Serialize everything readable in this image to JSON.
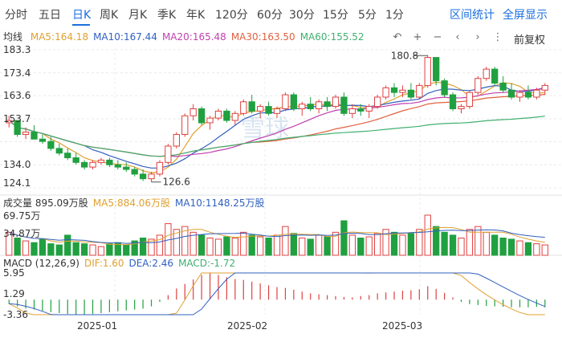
{
  "tabs": {
    "items": [
      "分时",
      "五日",
      "日K",
      "周K",
      "月K",
      "季K",
      "年K",
      "120分",
      "60分",
      "30分",
      "15分",
      "5分",
      "1分"
    ],
    "active_index": 2,
    "right": [
      "区间统计",
      "全屏显示"
    ]
  },
  "ma_legend": {
    "title": "均线",
    "items": [
      {
        "text": "MA5:164.18",
        "color": "#e0a030"
      },
      {
        "text": "MA10:167.44",
        "color": "#3060c0"
      },
      {
        "text": "MA20:165.48",
        "color": "#c040b0"
      },
      {
        "text": "MA30:163.50",
        "color": "#e06040"
      },
      {
        "text": "MA60:155.52",
        "color": "#40b070"
      }
    ]
  },
  "toolbar": {
    "icons": [
      "undo-icon",
      "zoom-in-icon",
      "zoom-out-icon",
      "prev-icon",
      "next-icon",
      "more-icon"
    ],
    "glyphs": [
      "↶",
      "+",
      "−",
      "‹",
      "›",
      "⋮"
    ],
    "adjust_label": "前复权"
  },
  "price_axis": [
    "183.3",
    "173.4",
    "163.6",
    "153.7",
    "134.0",
    "124.1"
  ],
  "annotations": {
    "high": "180.8",
    "low": "126.6"
  },
  "volume_legend": {
    "items": [
      {
        "text": "成交量 895.09万股",
        "color": "#333333"
      },
      {
        "text": "MA5:884.06万股",
        "color": "#e0a030"
      },
      {
        "text": "MA10:1148.25万股",
        "color": "#3060c0"
      }
    ],
    "axis": [
      "69.75万",
      "34.87万"
    ]
  },
  "macd_legend": {
    "items": [
      {
        "text": "MACD (12,26,9)",
        "color": "#333333"
      },
      {
        "text": "DIF:1.60",
        "color": "#e0a030"
      },
      {
        "text": "DEA:2.46",
        "color": "#3060c0"
      },
      {
        "text": "MACD:-1.72",
        "color": "#40b070"
      }
    ],
    "axis": [
      "5.95",
      "1.29",
      "-3.36"
    ]
  },
  "x_dates": [
    "2025-01",
    "2025-02",
    "2025-03"
  ],
  "watermark": "雪球",
  "colors": {
    "up": "#e04040",
    "down": "#20a040",
    "active": "#1a6fe0"
  },
  "chart_data": {
    "type": "candlestick",
    "ylim": [
      124.1,
      183.3
    ],
    "candles": [
      [
        152,
        155,
        150,
        153
      ],
      [
        153,
        153,
        146,
        147
      ],
      [
        147,
        150,
        145,
        148
      ],
      [
        148,
        151,
        146,
        145
      ],
      [
        145,
        147,
        143,
        144
      ],
      [
        144,
        146,
        140,
        141
      ],
      [
        141,
        143,
        138,
        139
      ],
      [
        139,
        141,
        136,
        137
      ],
      [
        137,
        139,
        134,
        135
      ],
      [
        135,
        136,
        132,
        133
      ],
      [
        133,
        136,
        132,
        135
      ],
      [
        135,
        137,
        134,
        136
      ],
      [
        136,
        137,
        133,
        134
      ],
      [
        134,
        136,
        132,
        133
      ],
      [
        133,
        135,
        131,
        132
      ],
      [
        132,
        133,
        129,
        130
      ],
      [
        130,
        132,
        127,
        128
      ],
      [
        128,
        131,
        126.6,
        130
      ],
      [
        130,
        136,
        129,
        135
      ],
      [
        135,
        143,
        134,
        142
      ],
      [
        142,
        148,
        141,
        147
      ],
      [
        147,
        156,
        146,
        155
      ],
      [
        155,
        160,
        153,
        158
      ],
      [
        158,
        159,
        151,
        152
      ],
      [
        152,
        155,
        149,
        154
      ],
      [
        154,
        158,
        153,
        157
      ],
      [
        157,
        158,
        152,
        153
      ],
      [
        153,
        157,
        151,
        156
      ],
      [
        156,
        162,
        155,
        161
      ],
      [
        161,
        164,
        156,
        157
      ],
      [
        157,
        160,
        154,
        159
      ],
      [
        159,
        161,
        155,
        156
      ],
      [
        156,
        159,
        154,
        158
      ],
      [
        158,
        165,
        157,
        164
      ],
      [
        164,
        165,
        157,
        158
      ],
      [
        158,
        161,
        155,
        160
      ],
      [
        160,
        163,
        157,
        158
      ],
      [
        158,
        162,
        156,
        161
      ],
      [
        161,
        163,
        157,
        159
      ],
      [
        159,
        164,
        158,
        163
      ],
      [
        163,
        165,
        155,
        156
      ],
      [
        156,
        160,
        154,
        158
      ],
      [
        158,
        160,
        155,
        157
      ],
      [
        157,
        160,
        154,
        159
      ],
      [
        159,
        164,
        158,
        163
      ],
      [
        163,
        168,
        162,
        167
      ],
      [
        167,
        169,
        163,
        165
      ],
      [
        165,
        168,
        163,
        166
      ],
      [
        166,
        169,
        162,
        163
      ],
      [
        163,
        169,
        162,
        168
      ],
      [
        168,
        181,
        167,
        180
      ],
      [
        180,
        176,
        168,
        170
      ],
      [
        170,
        171,
        163,
        164
      ],
      [
        164,
        165,
        157,
        158
      ],
      [
        158,
        160,
        156,
        159
      ],
      [
        159,
        166,
        158,
        165
      ],
      [
        165,
        172,
        164,
        171
      ],
      [
        171,
        176,
        170,
        175
      ],
      [
        175,
        176,
        168,
        169
      ],
      [
        169,
        172,
        165,
        166
      ],
      [
        166,
        169,
        162,
        163
      ],
      [
        163,
        166,
        161,
        165
      ],
      [
        165,
        168,
        162,
        163
      ],
      [
        163,
        167,
        162,
        166
      ],
      [
        166,
        169,
        164,
        168
      ]
    ],
    "volume": [
      40,
      30,
      25,
      22,
      28,
      20,
      18,
      35,
      22,
      20,
      18,
      15,
      20,
      22,
      18,
      25,
      30,
      28,
      35,
      55,
      45,
      50,
      40,
      35,
      30,
      28,
      32,
      30,
      40,
      35,
      32,
      30,
      35,
      50,
      38,
      30,
      28,
      35,
      32,
      40,
      60,
      35,
      30,
      32,
      38,
      45,
      40,
      35,
      38,
      45,
      69.75,
      50,
      40,
      35,
      30,
      45,
      50,
      40,
      35,
      30,
      28,
      25,
      22,
      20,
      18
    ],
    "macd_hist": [
      -1,
      -1.5,
      -2,
      -2.2,
      -2.5,
      -2.8,
      -3,
      -3.2,
      -3.3,
      -3.36,
      -3.2,
      -3,
      -2.8,
      -2.6,
      -2.4,
      -2.2,
      -2,
      -1.5,
      -0.5,
      1,
      2.5,
      3.5,
      4.5,
      5.5,
      5.95,
      5.5,
      5,
      4.6,
      4.4,
      4,
      3.6,
      3.2,
      2.8,
      2.6,
      2.2,
      1.8,
      1.4,
      1.2,
      1,
      0.8,
      0.6,
      0.5,
      0.8,
      1,
      1.4,
      1.6,
      1.8,
      2,
      2.1,
      2.3,
      3,
      2.4,
      1.5,
      0.5,
      -0.5,
      -1,
      -1.2,
      -1.4,
      -1.5,
      -1.6,
      -1.7,
      -1.7,
      -1.72,
      -1.6,
      -1.72
    ]
  }
}
